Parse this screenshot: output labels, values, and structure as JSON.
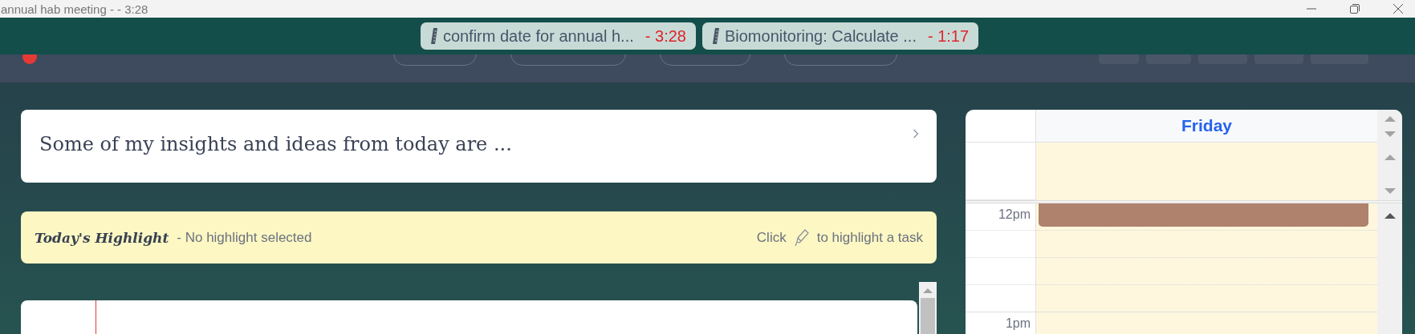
{
  "window": {
    "title": "annual hab meeting - - 3:28"
  },
  "timers": [
    {
      "task": "confirm date for annual h...",
      "remaining": "- 3:28"
    },
    {
      "task": "Biomonitoring: Calculate ...",
      "remaining": "- 1:17"
    }
  ],
  "reflection": {
    "prompt": "Some of my insights and ideas from today are ..."
  },
  "highlight": {
    "title": "Today's Highlight",
    "status": "- No highlight selected",
    "hint_before": "Click",
    "hint_after": "to highlight a task"
  },
  "calendar": {
    "day": "Friday",
    "hours": [
      {
        "label": "12pm"
      },
      {
        "label": "1pm"
      }
    ]
  }
}
